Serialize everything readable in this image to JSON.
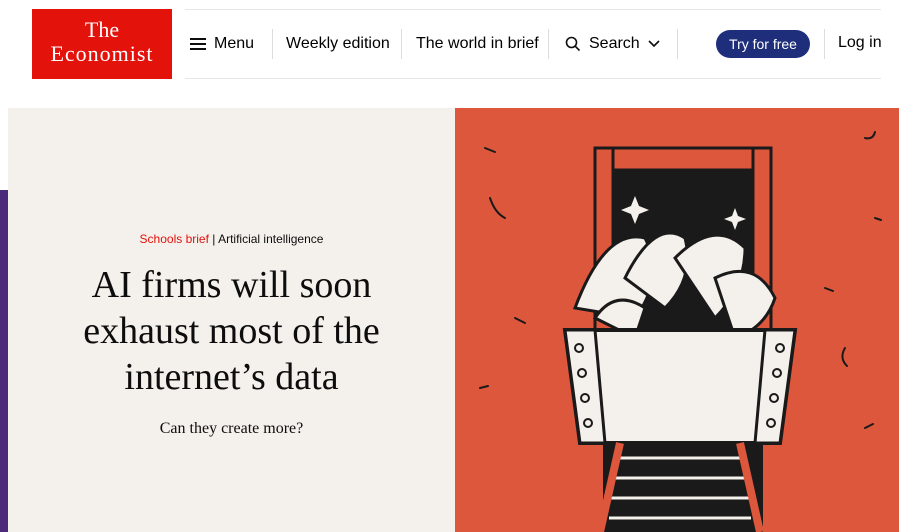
{
  "brand": {
    "logo_line1": "The",
    "logo_line2": "Economist",
    "color": "#e3120b"
  },
  "nav": {
    "menu_label": "Menu",
    "weekly_label": "Weekly edition",
    "world_label": "The world in brief",
    "search_label": "Search",
    "try_label": "Try for free",
    "login_label": "Log in"
  },
  "hero": {
    "kicker_section": "Schools brief",
    "kicker_divider": "|",
    "kicker_topic": "Artificial intelligence",
    "headline_line1": "AI firms will soon",
    "headline_line2": "exhaust most of the",
    "headline_line3": "internet’s data",
    "subhead": "Can they create more?",
    "image_icon": "mine-cart-illustration"
  },
  "colors": {
    "accent_red": "#e3120b",
    "button_blue": "#1f2e7a",
    "hero_bg": "#f4f1ec",
    "illustration_bg": "#dd573d",
    "side_bar": "#4b2a7b"
  }
}
